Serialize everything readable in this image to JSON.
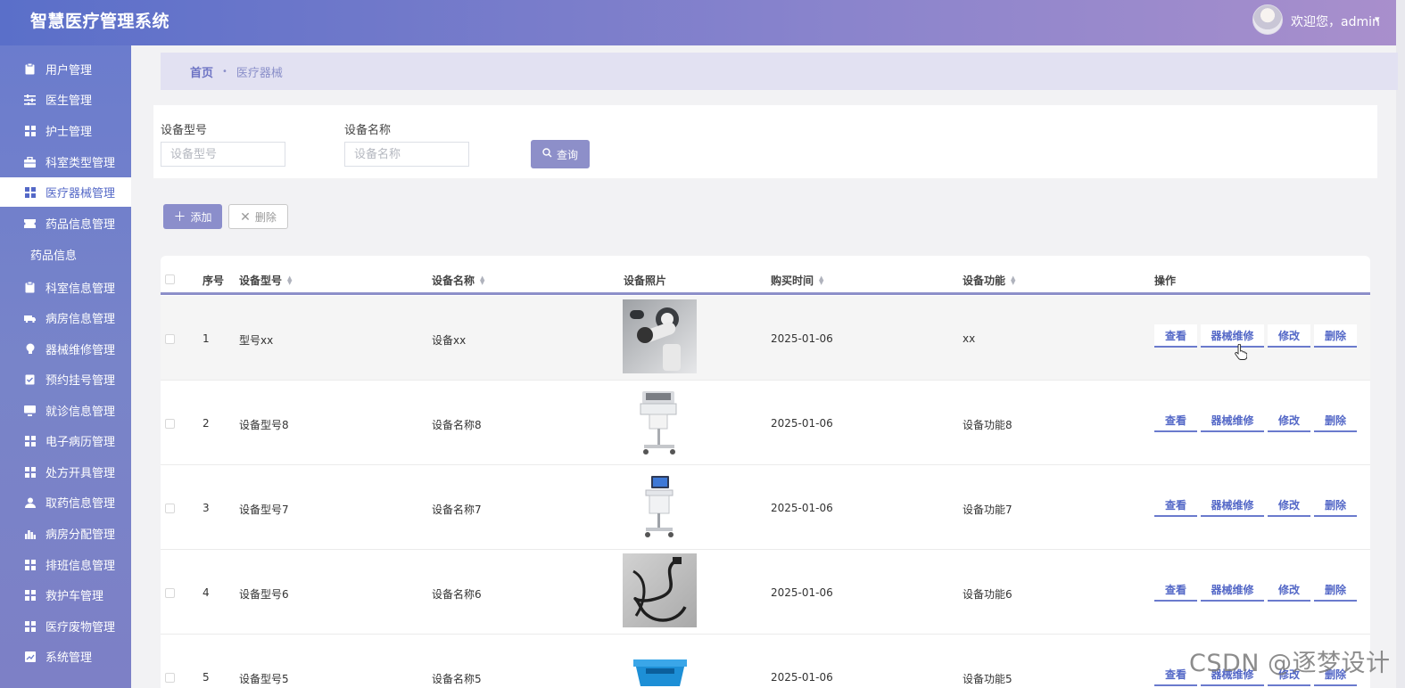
{
  "header": {
    "app_title": "智慧医疗管理系统",
    "welcome": "欢迎您，admin",
    "caret": "▾"
  },
  "sidebar": {
    "items": [
      {
        "label": "用户管理",
        "icon": "clipboard-icon"
      },
      {
        "label": "医生管理",
        "icon": "sliders-icon"
      },
      {
        "label": "护士管理",
        "icon": "grid-icon"
      },
      {
        "label": "科室类型管理",
        "icon": "briefcase-icon"
      },
      {
        "label": "医疗器械管理",
        "icon": "grid-icon",
        "active": true
      },
      {
        "label": "药品信息管理",
        "icon": "ticket-icon"
      },
      {
        "label": "科室信息管理",
        "icon": "clipboard-icon"
      },
      {
        "label": "病房信息管理",
        "icon": "truck-icon"
      },
      {
        "label": "器械维修管理",
        "icon": "bulb-icon"
      },
      {
        "label": "预约挂号管理",
        "icon": "check-clipboard-icon"
      },
      {
        "label": "就诊信息管理",
        "icon": "monitor-icon"
      },
      {
        "label": "电子病历管理",
        "icon": "grid-icon"
      },
      {
        "label": "处方开具管理",
        "icon": "grid-icon"
      },
      {
        "label": "取药信息管理",
        "icon": "user-icon"
      },
      {
        "label": "病房分配管理",
        "icon": "bar-chart-icon"
      },
      {
        "label": "排班信息管理",
        "icon": "grid-icon"
      },
      {
        "label": "救护车管理",
        "icon": "grid-icon"
      },
      {
        "label": "医疗废物管理",
        "icon": "grid-icon"
      },
      {
        "label": "系统管理",
        "icon": "line-chart-icon"
      }
    ],
    "sub_item": "药品信息"
  },
  "breadcrumb": {
    "home": "首页",
    "separator": "•",
    "current": "医疗器械"
  },
  "search": {
    "model_label": "设备型号",
    "model_placeholder": "设备型号",
    "name_label": "设备名称",
    "name_placeholder": "设备名称",
    "query_button": "查询"
  },
  "actions": {
    "add": "添加",
    "delete": "删除"
  },
  "table": {
    "columns": [
      "序号",
      "设备型号",
      "设备名称",
      "设备照片",
      "购买时间",
      "设备功能",
      "操作"
    ],
    "row_buttons": [
      "查看",
      "器械维修",
      "修改",
      "删除"
    ],
    "rows": [
      {
        "index": "1",
        "model": "型号xx",
        "name": "设备xx",
        "photo": "robot-arm",
        "date": "2025-01-06",
        "func": "xx"
      },
      {
        "index": "2",
        "model": "设备型号8",
        "name": "设备名称8",
        "photo": "medical-cart",
        "date": "2025-01-06",
        "func": "设备功能8"
      },
      {
        "index": "3",
        "model": "设备型号7",
        "name": "设备名称7",
        "photo": "ultrasound-cart",
        "date": "2025-01-06",
        "func": "设备功能7"
      },
      {
        "index": "4",
        "model": "设备型号6",
        "name": "设备名称6",
        "photo": "endoscope-cable",
        "date": "2025-01-06",
        "func": "设备功能6"
      },
      {
        "index": "5",
        "model": "设备型号5",
        "name": "设备名称5",
        "photo": "blue-device",
        "date": "2025-01-06",
        "func": "设备功能5"
      }
    ]
  },
  "watermark": "CSDN @逐梦设计",
  "colors": {
    "accent": "#5468c7",
    "header_gradient_start": "#5a6fc9",
    "header_gradient_end": "#a98fcc",
    "button": "#8d8fc9"
  }
}
